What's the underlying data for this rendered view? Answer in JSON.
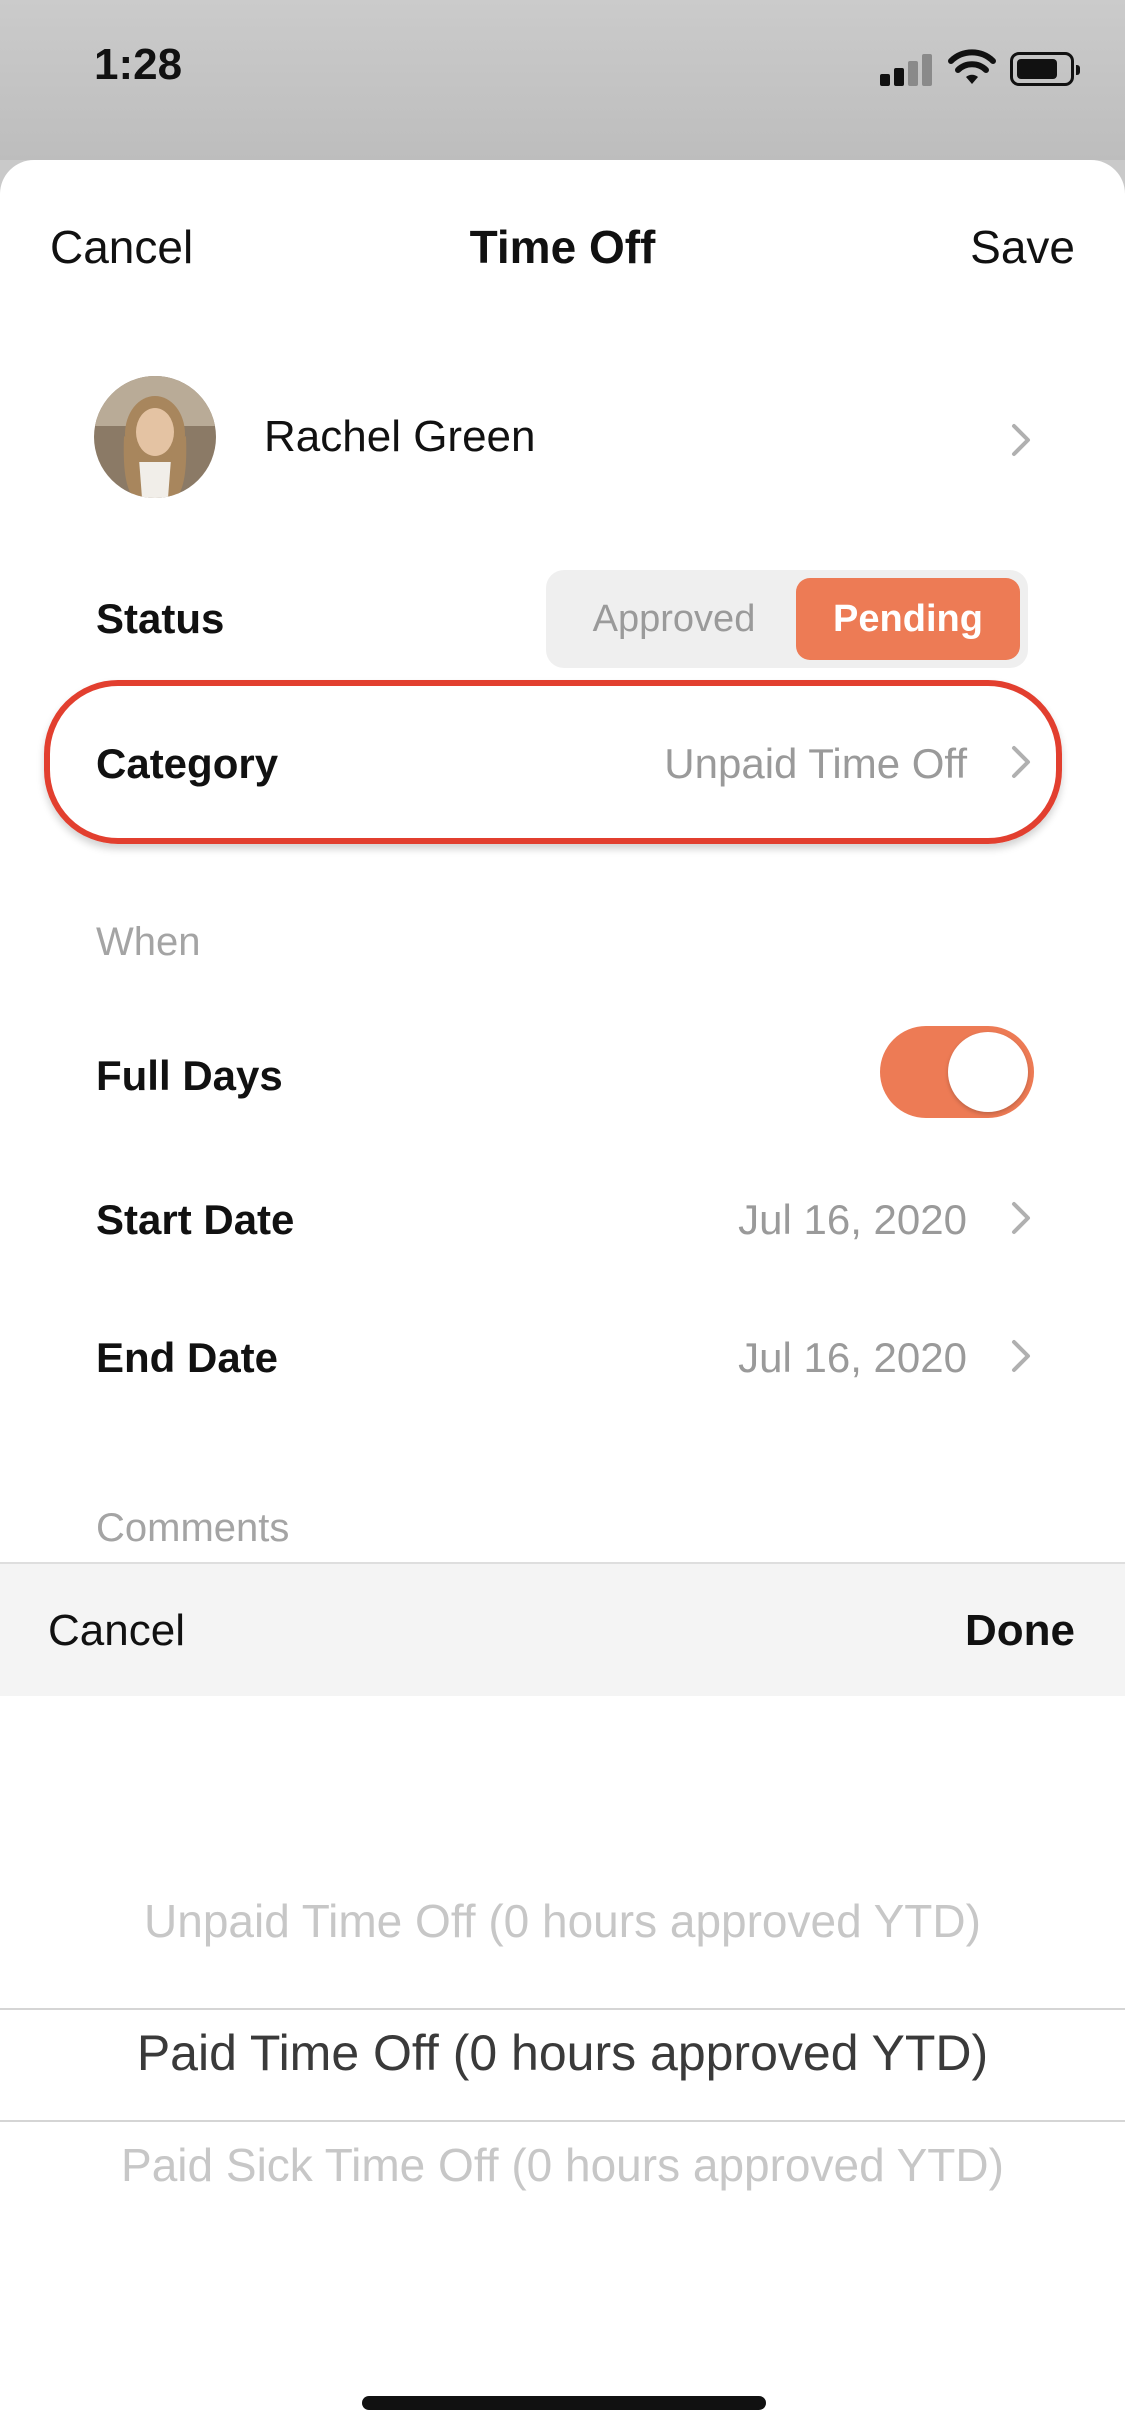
{
  "status_bar": {
    "time": "1:28"
  },
  "nav": {
    "cancel": "Cancel",
    "title": "Time Off",
    "save": "Save"
  },
  "employee": {
    "name": "Rachel Green"
  },
  "status": {
    "label": "Status",
    "options": [
      "Approved",
      "Pending"
    ],
    "selected": "Pending"
  },
  "category": {
    "label": "Category",
    "value": "Unpaid Time Off"
  },
  "when": {
    "section_title": "When",
    "full_days": {
      "label": "Full Days",
      "on": true
    },
    "start_date": {
      "label": "Start Date",
      "value": "Jul 16, 2020"
    },
    "end_date": {
      "label": "End Date",
      "value": "Jul 16, 2020"
    }
  },
  "comments": {
    "section_title": "Comments"
  },
  "picker_toolbar": {
    "cancel": "Cancel",
    "done": "Done"
  },
  "picker": {
    "options": [
      "Unpaid Time Off (0 hours approved YTD)",
      "Paid Time Off (0 hours approved YTD)",
      "Paid Sick Time Off (0 hours approved YTD)"
    ],
    "selected": "Paid Time Off (0 hours approved YTD)"
  },
  "colors": {
    "accent": "#ed7b55",
    "highlight": "#e23f2f"
  }
}
